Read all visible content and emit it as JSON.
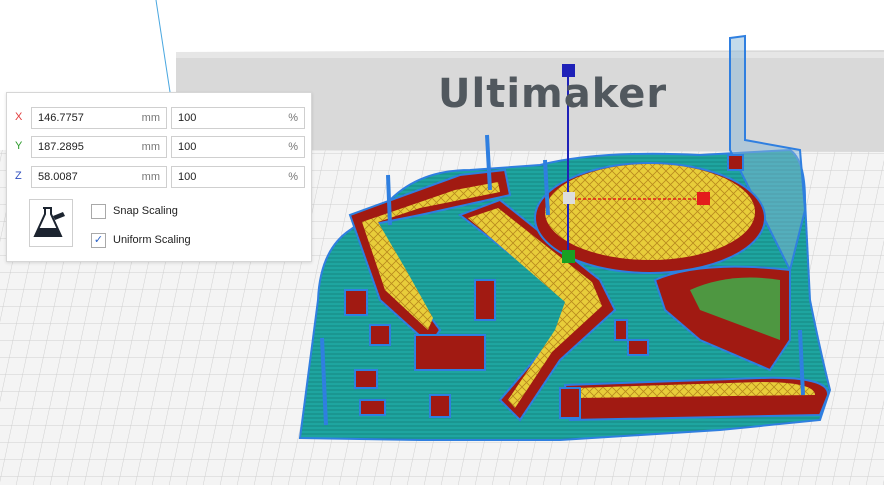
{
  "viewport": {
    "logo_text": "Ultimaker",
    "colors": {
      "background": "#ffffff",
      "build_plate_grid": "#cfcfcf",
      "skirt": "#1ea5a0",
      "outline": "#2f7fe0",
      "wall": "#a11a12",
      "infill": "#e8cd3a",
      "support": "#3fae4a"
    },
    "gizmo": {
      "x_axis_color": "#e31c1c",
      "y_axis_color": "#17a023",
      "z_axis_color": "#1e21b8"
    }
  },
  "scale_panel": {
    "rows": [
      {
        "axis": "X",
        "axis_color": "#e23b3b",
        "value": "146.7757",
        "unit": "mm",
        "percent": "100",
        "percent_unit": "%"
      },
      {
        "axis": "Y",
        "axis_color": "#2a9a2a",
        "value": "187.2895",
        "unit": "mm",
        "percent": "100",
        "percent_unit": "%"
      },
      {
        "axis": "Z",
        "axis_color": "#2f4fbf",
        "value": "58.0087",
        "unit": "mm",
        "percent": "100",
        "percent_unit": "%"
      }
    ],
    "tool_icon": "scale-tool-icon",
    "snap_scaling": {
      "label": "Snap Scaling",
      "checked": false
    },
    "uniform_scaling": {
      "label": "Uniform Scaling",
      "checked": true,
      "check_glyph": "✓"
    }
  }
}
